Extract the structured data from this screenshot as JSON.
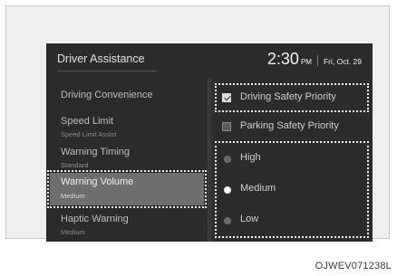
{
  "header": {
    "title": "Driver Assistance",
    "time": "2:30",
    "ampm": "PM",
    "date": "Fri, Oct. 29"
  },
  "menu": {
    "items": [
      {
        "label": "Driving Convenience",
        "sub": ""
      },
      {
        "label": "Speed Limit",
        "sub": "Speed Limit Assist"
      },
      {
        "label": "Warning Timing",
        "sub": "Standard"
      },
      {
        "label": "Warning Volume",
        "sub": "Medium",
        "selected": true
      },
      {
        "label": "Haptic Warning",
        "sub": "Medium"
      }
    ]
  },
  "options": {
    "priority": [
      {
        "label": "Driving Safety Priority",
        "checked": true
      },
      {
        "label": "Parking Safety Priority",
        "checked": false
      }
    ],
    "volume": [
      {
        "label": "High",
        "selected": false
      },
      {
        "label": "Medium",
        "selected": true
      },
      {
        "label": "Low",
        "selected": false
      }
    ]
  },
  "caption": "OJWEV071238L"
}
